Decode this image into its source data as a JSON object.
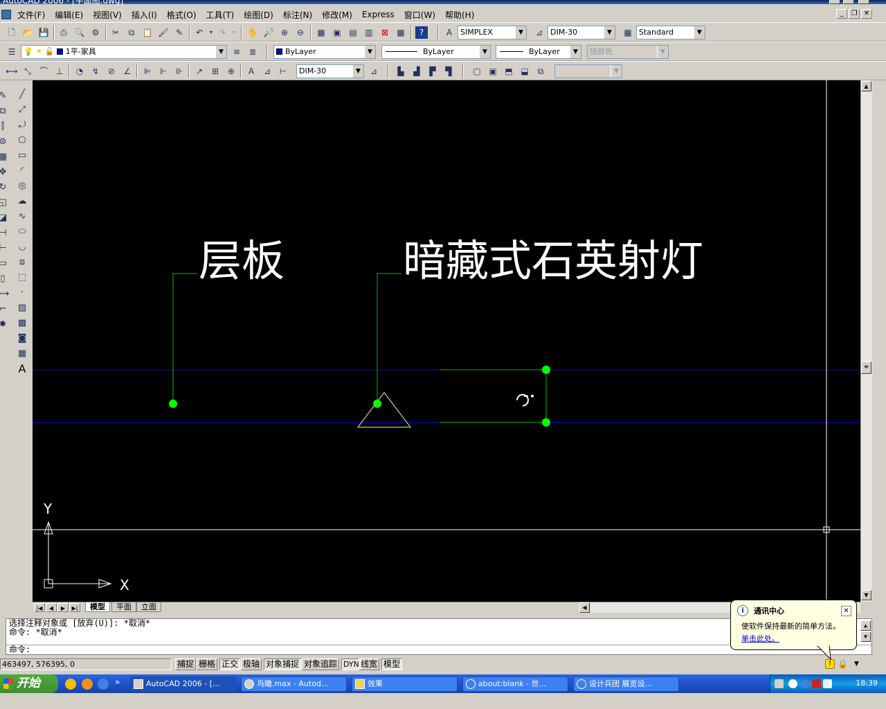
{
  "app": {
    "title": "AutoCAD 2006 - [平面图.dwg]"
  },
  "menu": [
    "文件(F)",
    "编辑(E)",
    "视图(V)",
    "插入(I)",
    "格式(O)",
    "工具(T)",
    "绘图(D)",
    "标注(N)",
    "修改(M)",
    "Express",
    "窗口(W)",
    "帮助(H)"
  ],
  "toolbar": {
    "text_style": "SIMPLEX",
    "dim_style": "DIM-30",
    "table_style": "Standard",
    "layer": "1平-家具",
    "color": "ByLayer",
    "linetype": "ByLayer",
    "lineweight": "ByLayer",
    "plot_style": "随颜色",
    "dim_style2": "DIM-30"
  },
  "drawing": {
    "label1": "层板",
    "label2": "暗藏式石英射灯",
    "ucs_x": "X",
    "ucs_y": "Y",
    "colors": {
      "background": "#000000",
      "leader": "#00c000",
      "grip": "#00ff00",
      "guide": "#0000ff",
      "text": "#ffffff",
      "triangle": "#ffff80"
    }
  },
  "tabs": [
    "模型",
    "平面",
    "立面"
  ],
  "command": {
    "line1": "选择注释对象或 [放弃(U)]: *取消*",
    "line2": "命令: *取消*",
    "prompt": "命令:"
  },
  "status": {
    "coords": "463497, 576395, 0",
    "buttons": [
      "捕捉",
      "栅格",
      "正交",
      "极轴",
      "对象捕捉",
      "对象追踪",
      "DYN",
      "线宽",
      "模型"
    ]
  },
  "balloon": {
    "title": "通讯中心",
    "message": "使软件保持最新的简单方法。",
    "link": "单击此处。"
  },
  "taskbar": {
    "start": "开始",
    "tasks": [
      "AutoCAD 2006 - [...",
      "鸟瞰.max - Autod...",
      "效果",
      "about:blank - 世...",
      "设计兵团 展览设..."
    ],
    "clock": "18:39"
  }
}
